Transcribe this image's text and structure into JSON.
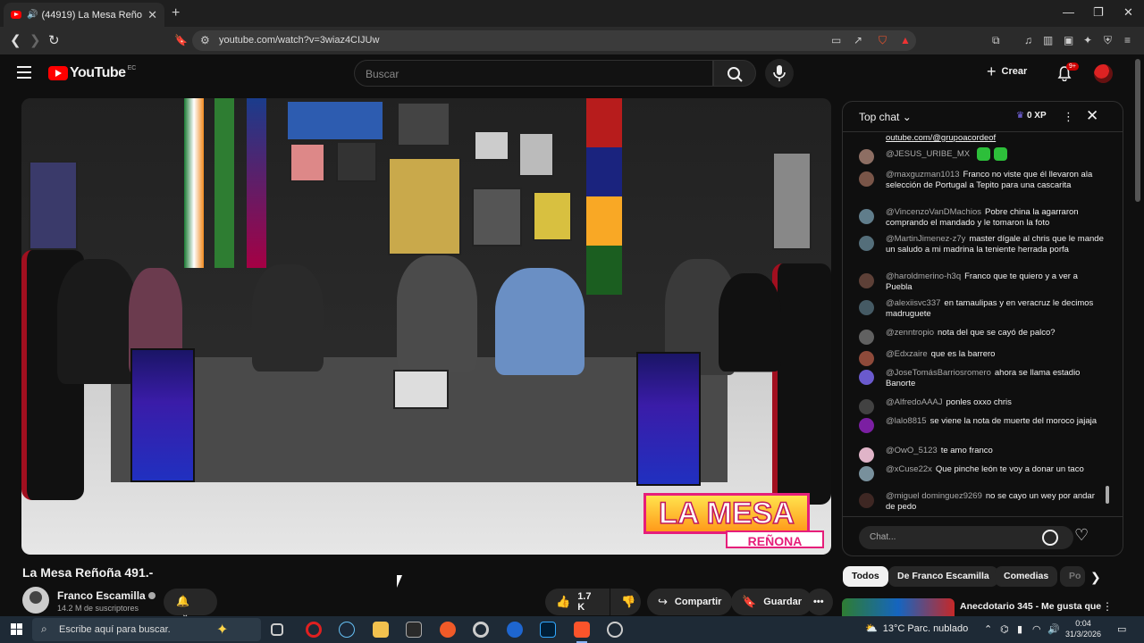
{
  "browser": {
    "tab_title": "(44919) La Mesa Reñoña 491.-",
    "url": "youtube.com/watch?v=3wiaz4CIJUw"
  },
  "youtube": {
    "logo_text": "YouTube",
    "country_code": "EC",
    "search_placeholder": "Buscar",
    "create_label": "Crear",
    "notifications_badge": "9+"
  },
  "video": {
    "overlay_title": "LA MESA",
    "overlay_subtitle": "REÑONA",
    "title": "La Mesa Reñoña 491.-",
    "channel_name": "Franco Escamilla",
    "subscribers": "14.2 M de suscriptores",
    "likes": "1.7 K",
    "share_label": "Compartir",
    "save_label": "Guardar"
  },
  "chat": {
    "header_label": "Top chat",
    "xp_label": "0 XP",
    "input_placeholder": "Chat...",
    "messages": [
      {
        "user": "",
        "text": "outube.com/@grupoacordeof",
        "color": "#6d4c41"
      },
      {
        "user": "@JESUS_URIBE_MX",
        "text": "",
        "color": "#8d6e63"
      },
      {
        "user": "@maxguzman1013",
        "text": "Franco no viste que él llevaron ala selección de Portugal a Tepito para una cascarita",
        "color": "#795548"
      },
      {
        "user": "@VincenzoVanDMachios",
        "text": "Pobre china la agarraron comprando el mandado y le tomaron la foto",
        "color": "#607d8b"
      },
      {
        "user": "@MartinJimenez-z7y",
        "text": "master dígale al chris que le mande un saludo a mi madrina la teniente herrada porfa",
        "color": "#546e7a"
      },
      {
        "user": "@haroldmerino-h3q",
        "text": "Franco que te quiero y a ver a Puebla",
        "color": "#5d4037"
      },
      {
        "user": "@alexiisvc337",
        "text": "en tamaulipas y en veracruz le decimos madruguete",
        "color": "#455a64"
      },
      {
        "user": "@zenntropio",
        "text": "nota del que se cayó de palco?",
        "color": "#616161"
      },
      {
        "user": "@Edxzaire",
        "text": "que es la barrero",
        "color": "#8e4a3a"
      },
      {
        "user": "@JoseTomásBarriosromero",
        "text": "ahora se llama estadio Banorte",
        "color": "#6a5acd"
      },
      {
        "user": "@AlfredoAAAJ",
        "text": "ponles oxxo chris",
        "color": "#424242"
      },
      {
        "user": "@lalo8815",
        "text": "se viene la nota de muerte del moroco jajaja",
        "color": "#7b1fa2"
      },
      {
        "user": "@OwO_5123",
        "text": "te amo franco",
        "color": "#e0b4c8"
      },
      {
        "user": "@xCuse22x",
        "text": "Que pinche león te voy a donar un taco",
        "color": "#78909c"
      },
      {
        "user": "@miguel dominguez9269",
        "text": "no se cayo un wey por andar de pedo",
        "color": "#3e2723"
      }
    ]
  },
  "chips": [
    "Todos",
    "De Franco Escamilla",
    "Comedias",
    "Po"
  ],
  "recommendation": {
    "title": "Anecdotario 345 - Me gusta que"
  },
  "taskbar": {
    "search_placeholder": "Escribe aquí para buscar.",
    "weather": "13°C  Parc. nublado",
    "time": "0:04",
    "date": "31/3/2026"
  }
}
